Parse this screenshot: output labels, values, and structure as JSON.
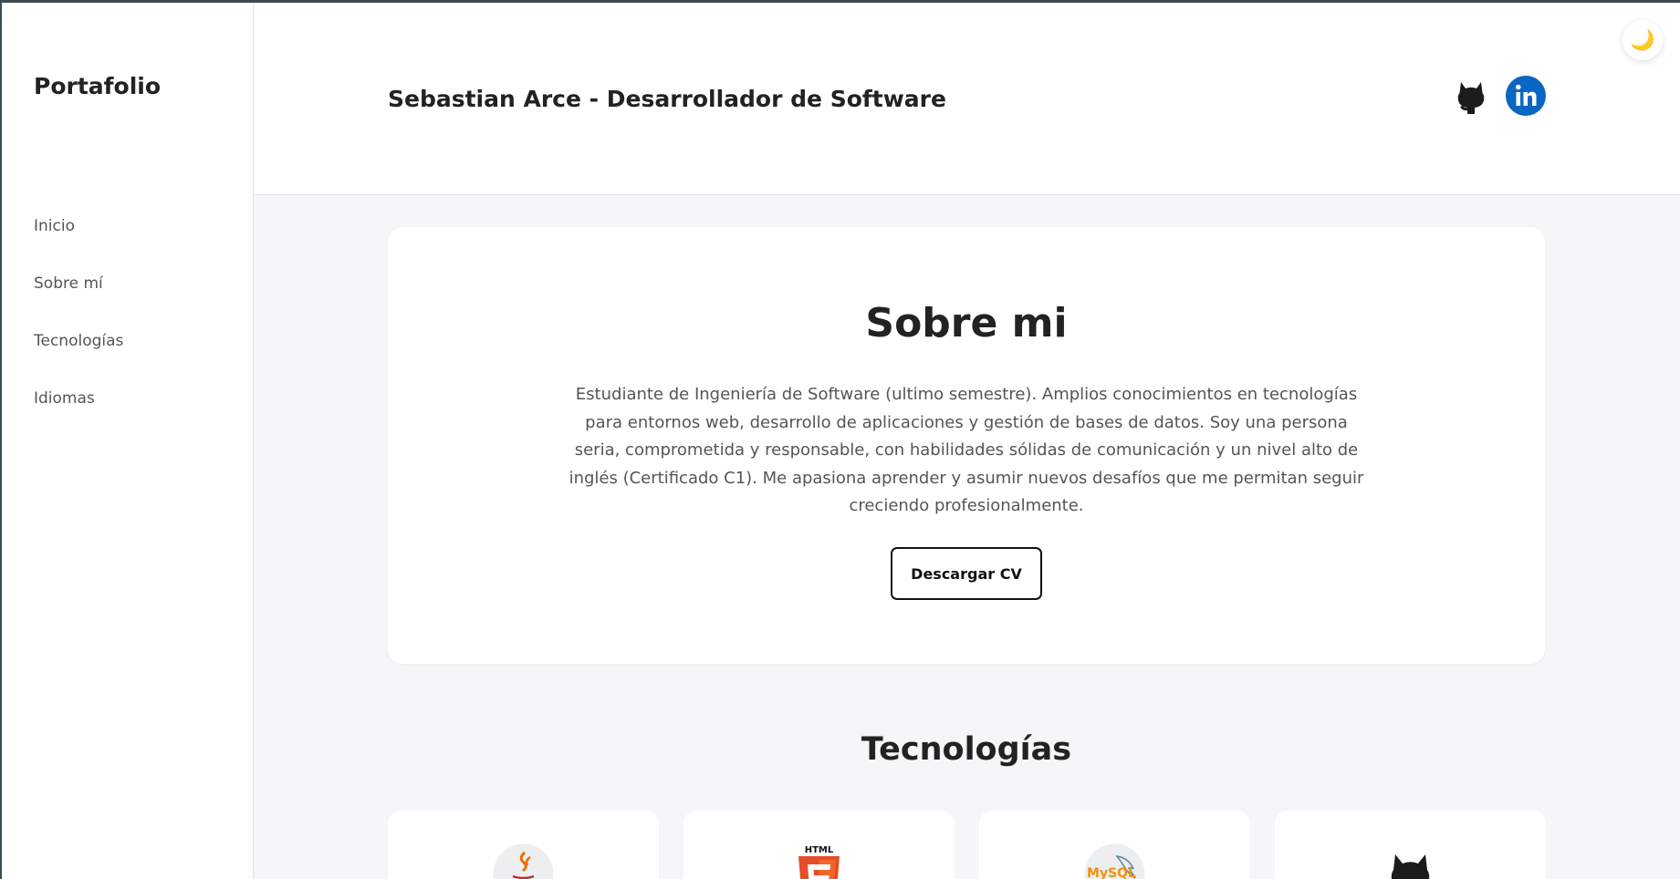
{
  "sidebar": {
    "brand": "Portafolio",
    "items": [
      {
        "label": "Inicio"
      },
      {
        "label": "Sobre mí"
      },
      {
        "label": "Tecnologías"
      },
      {
        "label": "Idiomas"
      }
    ]
  },
  "header": {
    "title": "Sebastian Arce - Desarrollador de Software",
    "github_icon": "github-icon",
    "linkedin_icon": "linkedin-icon",
    "theme_icon": "moon-icon"
  },
  "about": {
    "title": "Sobre mi",
    "text": "Estudiante de Ingeniería de Software (ultimo semestre). Amplios conocimientos en tecnologías para entornos web, desarrollo de aplicaciones y gestión de bases de datos. Soy una persona seria, comprometida y responsable, con habilidades sólidas de comunicación y un nivel alto de inglés (Certificado C1). Me apasiona aprender y asumir nuevos desafíos que me permitan seguir creciendo profesionalmente.",
    "cv_button": "Descargar CV"
  },
  "technologies": {
    "title": "Tecnologías",
    "items": [
      {
        "icon": "java-icon"
      },
      {
        "icon": "html5-icon",
        "label": "HTML"
      },
      {
        "icon": "mysql-icon",
        "label": "MySQL"
      },
      {
        "icon": "github-icon"
      }
    ]
  },
  "colors": {
    "linkedin": "#0a66c2",
    "html5": "#e44d26",
    "java": "#e76f00",
    "background": "#f5f6f8"
  }
}
